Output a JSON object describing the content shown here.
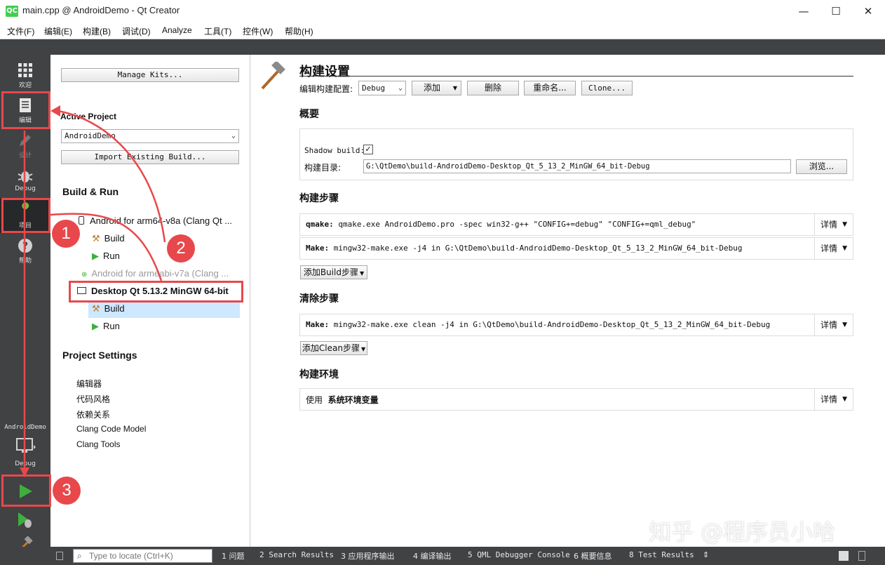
{
  "window": {
    "title": "main.cpp @ AndroidDemo - Qt Creator",
    "app_icon": "QC"
  },
  "menu": [
    "文件(F)",
    "编辑(E)",
    "构建(B)",
    "调试(D)",
    "Analyze",
    "工具(T)",
    "控件(W)",
    "帮助(H)"
  ],
  "modes": {
    "welcome": "欢迎",
    "edit": "编辑",
    "design": "设计",
    "debug": "Debug",
    "projects": "项目",
    "help": "帮助",
    "kit_project": "AndroidDemo",
    "kit_config": "Debug"
  },
  "left": {
    "manage_kits": "Manage Kits...",
    "active_project_label": "Active Project",
    "active_project": "AndroidDemo",
    "import_build": "Import Existing Build...",
    "build_run_header": "Build & Run",
    "kit1": "Android for arm64-v8a (Clang Qt ...",
    "build": "Build",
    "run": "Run",
    "kit2": "Android for armeabi-v7a (Clang ...",
    "kit3": "Desktop Qt 5.13.2 MinGW 64-bit",
    "project_settings_header": "Project Settings",
    "settings": [
      "编辑器",
      "代码风格",
      "依赖关系",
      "Clang Code Model",
      "Clang Tools"
    ]
  },
  "right": {
    "title": "构建设置",
    "edit_config_label": "编辑构建配置:",
    "config_value": "Debug",
    "add": "添加",
    "delete": "删除",
    "rename": "重命名...",
    "clone": "Clone...",
    "overview": "概要",
    "shadow_build": "Shadow build:",
    "build_dir_label": "构建目录:",
    "build_dir": "G:\\QtDemo\\build-AndroidDemo-Desktop_Qt_5_13_2_MinGW_64_bit-Debug",
    "browse": "浏览...",
    "build_steps": "构建步骤",
    "step1_key": "qmake:",
    "step1": " qmake.exe AndroidDemo.pro -spec win32-g++ \"CONFIG+=debug\" \"CONFIG+=qml_debug\"",
    "step2_key": "Make:",
    "step2": " mingw32-make.exe -j4 in G:\\QtDemo\\build-AndroidDemo-Desktop_Qt_5_13_2_MinGW_64_bit-Debug",
    "details": "详情",
    "add_build_step": "添加Build步骤",
    "clean_steps": "清除步骤",
    "clean_key": "Make:",
    "clean": " mingw32-make.exe clean -j4 in G:\\QtDemo\\build-AndroidDemo-Desktop_Qt_5_13_2_MinGW_64_bit-Debug",
    "add_clean_step": "添加Clean步骤",
    "build_env": "构建环境",
    "env_use": "使用",
    "env_value": "系统环境变量"
  },
  "bottom": {
    "locator_placeholder": "Type to locate (Ctrl+K)",
    "tabs": [
      "1 问题",
      "2 Search Results",
      "3 应用程序输出",
      "4 编译输出",
      "5 QML Debugger Console",
      "6 概要信息",
      "8 Test Results"
    ]
  },
  "annotations": {
    "b1": "1",
    "b2": "2",
    "b3": "3",
    "watermark": "知乎 @程序员小哈"
  },
  "colors": {
    "accent_red": "#e8484b",
    "modebar": "#404244",
    "run_green": "#3fae3f",
    "selection": "#cde8ff"
  }
}
